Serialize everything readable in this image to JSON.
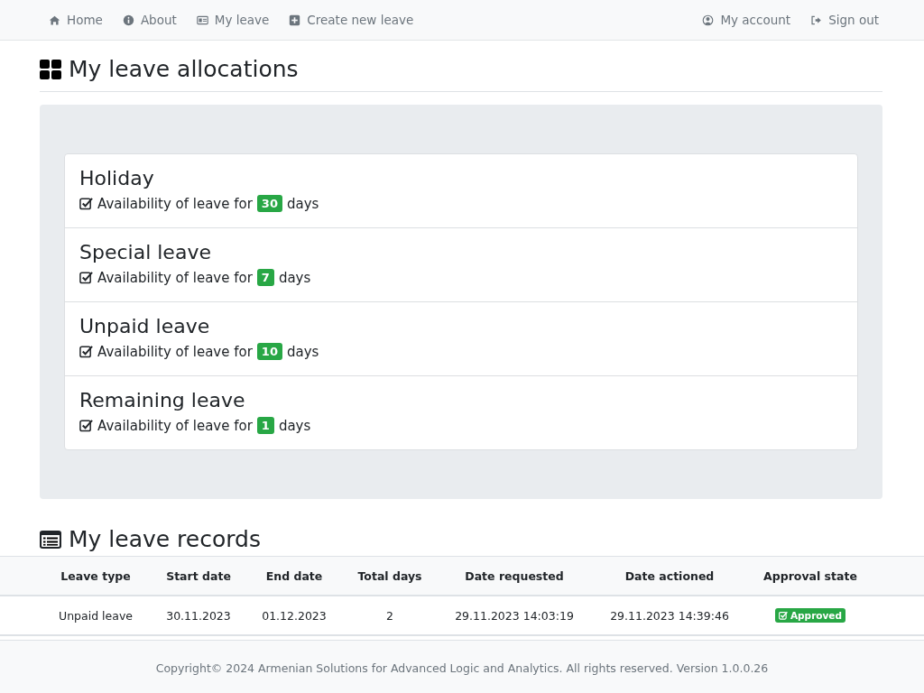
{
  "nav": {
    "left": [
      {
        "label": "Home",
        "kind": "home"
      },
      {
        "label": "About",
        "kind": "info"
      },
      {
        "label": "My leave",
        "kind": "card"
      },
      {
        "label": "Create new leave",
        "kind": "plus"
      }
    ],
    "right": [
      {
        "label": "My account",
        "kind": "user"
      },
      {
        "label": "Sign out",
        "kind": "signout"
      }
    ]
  },
  "allocations": {
    "title": "My leave allocations",
    "items": [
      {
        "name": "Holiday",
        "text": "Availability of leave for",
        "days": "30",
        "unit": "days"
      },
      {
        "name": "Special leave",
        "text": "Availability of leave for",
        "days": "7",
        "unit": "days"
      },
      {
        "name": "Unpaid leave",
        "text": "Availability of leave for",
        "days": "10",
        "unit": "days"
      },
      {
        "name": "Remaining leave",
        "text": "Availability of leave for",
        "days": "1",
        "unit": "days"
      }
    ]
  },
  "records": {
    "title": "My leave records",
    "columns": [
      "Leave type",
      "Start date",
      "End date",
      "Total days",
      "Date requested",
      "Date actioned",
      "Approval state"
    ],
    "rows": [
      {
        "cells": [
          "Unpaid leave",
          "30.11.2023",
          "01.12.2023",
          "2",
          "29.11.2023 14:03:19",
          "29.11.2023 14:39:46"
        ],
        "status": {
          "kind": "approved",
          "label": "Approved"
        }
      }
    ]
  },
  "footer": "Copyright© 2024 Armenian Solutions for Advanced Logic and Analytics. All rights reserved. Version 1.0.0.26"
}
